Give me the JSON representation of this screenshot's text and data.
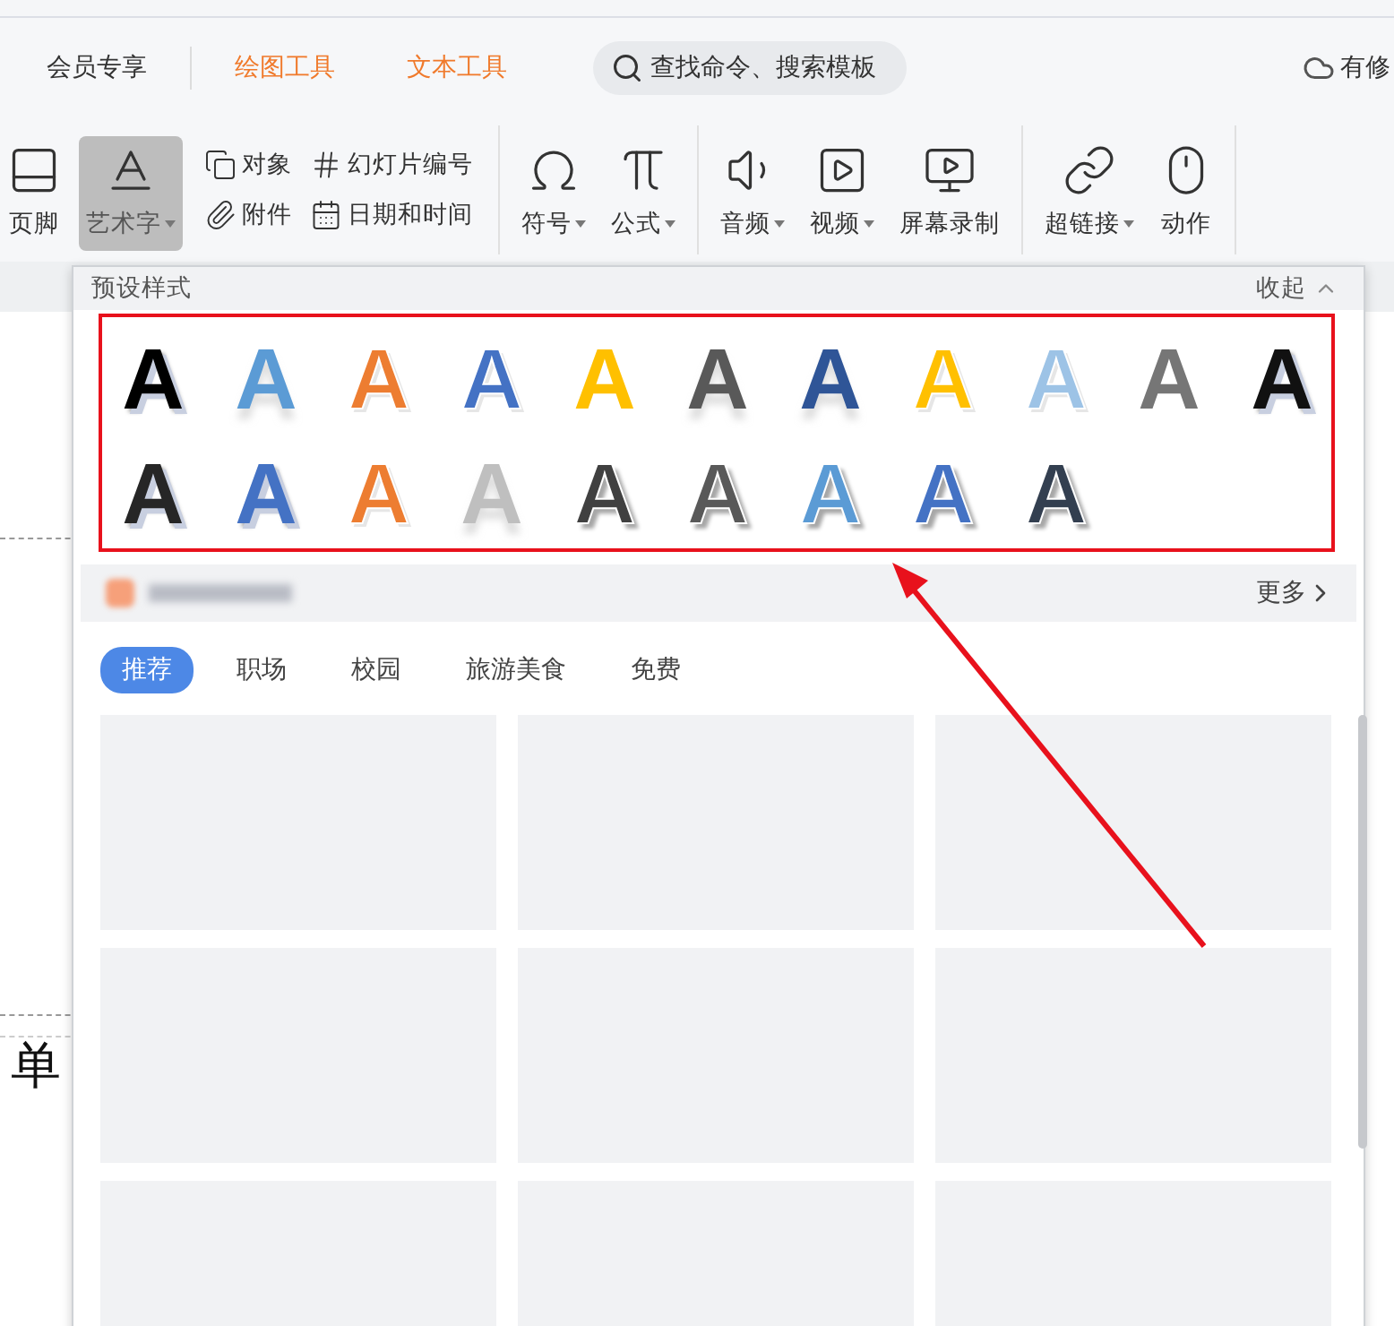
{
  "menu": {
    "items": [
      {
        "label": "会员专享",
        "kind": "plain"
      },
      {
        "label": "绘图工具",
        "kind": "context"
      },
      {
        "label": "文本工具",
        "kind": "context"
      }
    ],
    "search": {
      "placeholder": "查找命令、搜索模板"
    },
    "cloud": {
      "label": "有修"
    }
  },
  "ribbon": {
    "large_before": [
      {
        "label": "页脚",
        "dropdown": false,
        "selected": false
      },
      {
        "label": "艺术字",
        "dropdown": true,
        "selected": true
      }
    ],
    "small": [
      {
        "label": "对象"
      },
      {
        "label": "附件"
      },
      {
        "label": "幻灯片编号"
      },
      {
        "label": "日期和时间"
      }
    ],
    "groups": [
      [
        {
          "label": "符号",
          "dropdown": true,
          "selected": false
        },
        {
          "label": "公式",
          "dropdown": true,
          "selected": false
        }
      ],
      [
        {
          "label": "音频",
          "dropdown": true,
          "selected": false
        },
        {
          "label": "视频",
          "dropdown": true,
          "selected": false
        },
        {
          "label": "屏幕录制",
          "dropdown": false,
          "selected": false
        }
      ],
      [
        {
          "label": "超链接",
          "dropdown": true,
          "selected": false
        },
        {
          "label": "动作",
          "dropdown": false,
          "selected": false
        }
      ]
    ]
  },
  "document": {
    "text": "单"
  },
  "panel": {
    "title": "预设样式",
    "collapse": "收起",
    "styles": [
      {
        "letter": "A",
        "kind": "shadow",
        "color": "#000000"
      },
      {
        "letter": "A",
        "kind": "gradient",
        "color": "#5b9bd5"
      },
      {
        "letter": "A",
        "kind": "outline",
        "color": "#ed7d31"
      },
      {
        "letter": "A",
        "kind": "outline",
        "color": "#4472c4"
      },
      {
        "letter": "A",
        "kind": "solid",
        "color": "#ffc000"
      },
      {
        "letter": "A",
        "kind": "gradient",
        "color": "#595959"
      },
      {
        "letter": "A",
        "kind": "gradient",
        "color": "#2f5597"
      },
      {
        "letter": "A",
        "kind": "outline",
        "color": "#ffc000"
      },
      {
        "letter": "A",
        "kind": "outline",
        "color": "#9dc3e6"
      },
      {
        "letter": "A",
        "kind": "solid",
        "color": "#767676"
      },
      {
        "letter": "A",
        "kind": "shadow",
        "color": "#111111"
      },
      {
        "letter": "A",
        "kind": "shadow",
        "color": "#262626"
      },
      {
        "letter": "A",
        "kind": "shadow",
        "color": "#4472c4"
      },
      {
        "letter": "A",
        "kind": "outline",
        "color": "#ed7d31"
      },
      {
        "letter": "A",
        "kind": "gradient",
        "color": "#bfbfbf"
      },
      {
        "letter": "A",
        "kind": "striped",
        "color": "#404040"
      },
      {
        "letter": "A",
        "kind": "striped",
        "color": "#595959"
      },
      {
        "letter": "A",
        "kind": "striped",
        "color": "#5b9bd5"
      },
      {
        "letter": "A",
        "kind": "striped",
        "color": "#4472c4"
      },
      {
        "letter": "A",
        "kind": "striped",
        "color": "#333f50"
      }
    ],
    "more": "更多",
    "tabs": [
      {
        "label": "推荐",
        "selected": true
      },
      {
        "label": "职场",
        "selected": false
      },
      {
        "label": "校园",
        "selected": false
      },
      {
        "label": "旅游美食",
        "selected": false
      },
      {
        "label": "免费",
        "selected": false
      }
    ],
    "templates": [
      {
        "kind": "placeholder"
      },
      {
        "kind": "placeholder"
      },
      {
        "kind": "placeholder"
      },
      {
        "kind": "placeholder"
      },
      {
        "kind": "placeholder"
      },
      {
        "kind": "placeholder"
      },
      {
        "kind": "placeholder"
      },
      {
        "kind": "placeholder"
      },
      {
        "kind": "placeholder"
      }
    ]
  }
}
